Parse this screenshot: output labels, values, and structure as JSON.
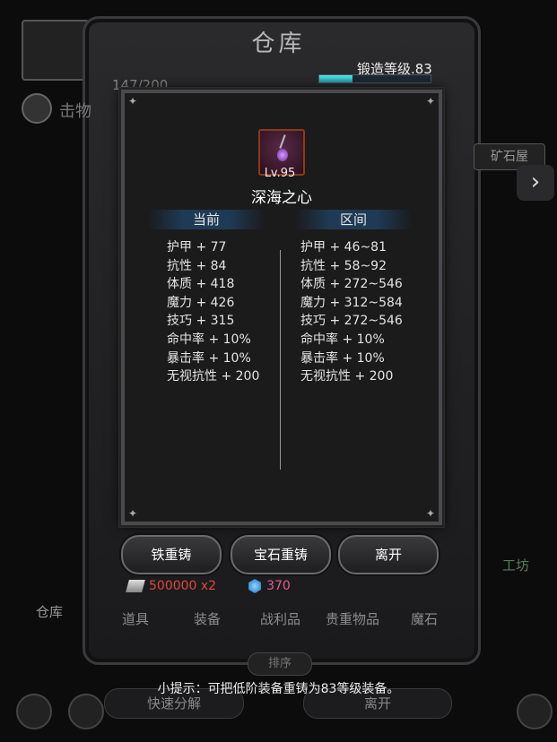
{
  "background": {
    "title": "仓库",
    "counter": "147/200",
    "left_label": "击物",
    "warehouse_label": "仓库",
    "ore_button": "矿石屋",
    "side_label": "工坊",
    "tabs": [
      "道具",
      "装备",
      "战利品",
      "贵重物品",
      "魔石"
    ],
    "sort_button": "排序",
    "quick_decompose": "快速分解",
    "leave_bottom": "离开"
  },
  "forge": {
    "label": "锻造等级.83",
    "progress": 0.3
  },
  "item": {
    "level": "Lv.95",
    "name": "深海之心",
    "icon": "purple-amulet-icon"
  },
  "columns": {
    "current_header": "当前",
    "range_header": "区间"
  },
  "current_stats": [
    "护甲 + 77",
    "抗性 + 84",
    "体质 + 418",
    "魔力 + 426",
    "技巧 + 315",
    "命中率 + 10%",
    "暴击率 + 10%",
    "无视抗性 + 200"
  ],
  "range_stats": [
    "护甲 + 46~81",
    "抗性 + 58~92",
    "体质 + 272~546",
    "魔力 + 312~584",
    "技巧 + 272~546",
    "命中率 + 10%",
    "暴击率 + 10%",
    "无视抗性 + 200"
  ],
  "buttons": {
    "iron_reforge": "铁重铸",
    "gem_reforge": "宝石重铸",
    "leave": "离开"
  },
  "currency": {
    "silver": "500000 x2",
    "gems": "370"
  },
  "tip": "小提示：可把低阶装备重铸为83等级装备。",
  "colors": {
    "popup_bg": "#1b1b1c",
    "header_band": "#1f3a55",
    "silver_text": "#e0483c",
    "gem_text": "#ec5a8a",
    "forge_fill": "#44cccc"
  }
}
